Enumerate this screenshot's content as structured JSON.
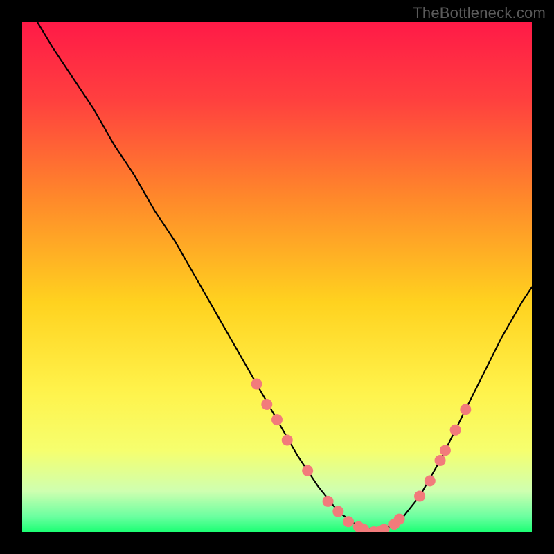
{
  "watermark": "TheBottleneck.com",
  "chart_data": {
    "type": "line",
    "title": "",
    "xlabel": "",
    "ylabel": "",
    "xlim": [
      0,
      100
    ],
    "ylim": [
      0,
      100
    ],
    "grid": false,
    "background_gradient": {
      "stops": [
        {
          "offset": 0.0,
          "color": "#ff1a47"
        },
        {
          "offset": 0.15,
          "color": "#ff3f3f"
        },
        {
          "offset": 0.35,
          "color": "#ff8a2a"
        },
        {
          "offset": 0.55,
          "color": "#ffd21f"
        },
        {
          "offset": 0.72,
          "color": "#fff24a"
        },
        {
          "offset": 0.84,
          "color": "#f6ff6e"
        },
        {
          "offset": 0.92,
          "color": "#cfffb0"
        },
        {
          "offset": 0.97,
          "color": "#6bffa0"
        },
        {
          "offset": 1.0,
          "color": "#1cff74"
        }
      ]
    },
    "series": [
      {
        "name": "curve",
        "x": [
          3,
          6,
          10,
          14,
          18,
          22,
          26,
          30,
          34,
          38,
          42,
          46,
          50,
          54,
          58,
          62,
          66,
          70,
          74,
          78,
          82,
          86,
          90,
          94,
          98,
          100
        ],
        "y": [
          100,
          95,
          89,
          83,
          76,
          70,
          63,
          57,
          50,
          43,
          36,
          29,
          22,
          15,
          9,
          4,
          1,
          0,
          2,
          7,
          14,
          22,
          30,
          38,
          45,
          48
        ]
      }
    ],
    "markers": {
      "name": "highlight-dots",
      "color": "#f27b7b",
      "radius": 8,
      "points": [
        {
          "x": 46,
          "y": 29
        },
        {
          "x": 48,
          "y": 25
        },
        {
          "x": 50,
          "y": 22
        },
        {
          "x": 52,
          "y": 18
        },
        {
          "x": 56,
          "y": 12
        },
        {
          "x": 60,
          "y": 6
        },
        {
          "x": 62,
          "y": 4
        },
        {
          "x": 64,
          "y": 2
        },
        {
          "x": 66,
          "y": 1
        },
        {
          "x": 67,
          "y": 0.5
        },
        {
          "x": 69,
          "y": 0
        },
        {
          "x": 70,
          "y": 0
        },
        {
          "x": 71,
          "y": 0.5
        },
        {
          "x": 73,
          "y": 1.5
        },
        {
          "x": 74,
          "y": 2.5
        },
        {
          "x": 78,
          "y": 7
        },
        {
          "x": 80,
          "y": 10
        },
        {
          "x": 82,
          "y": 14
        },
        {
          "x": 83,
          "y": 16
        },
        {
          "x": 85,
          "y": 20
        },
        {
          "x": 87,
          "y": 24
        }
      ]
    }
  }
}
